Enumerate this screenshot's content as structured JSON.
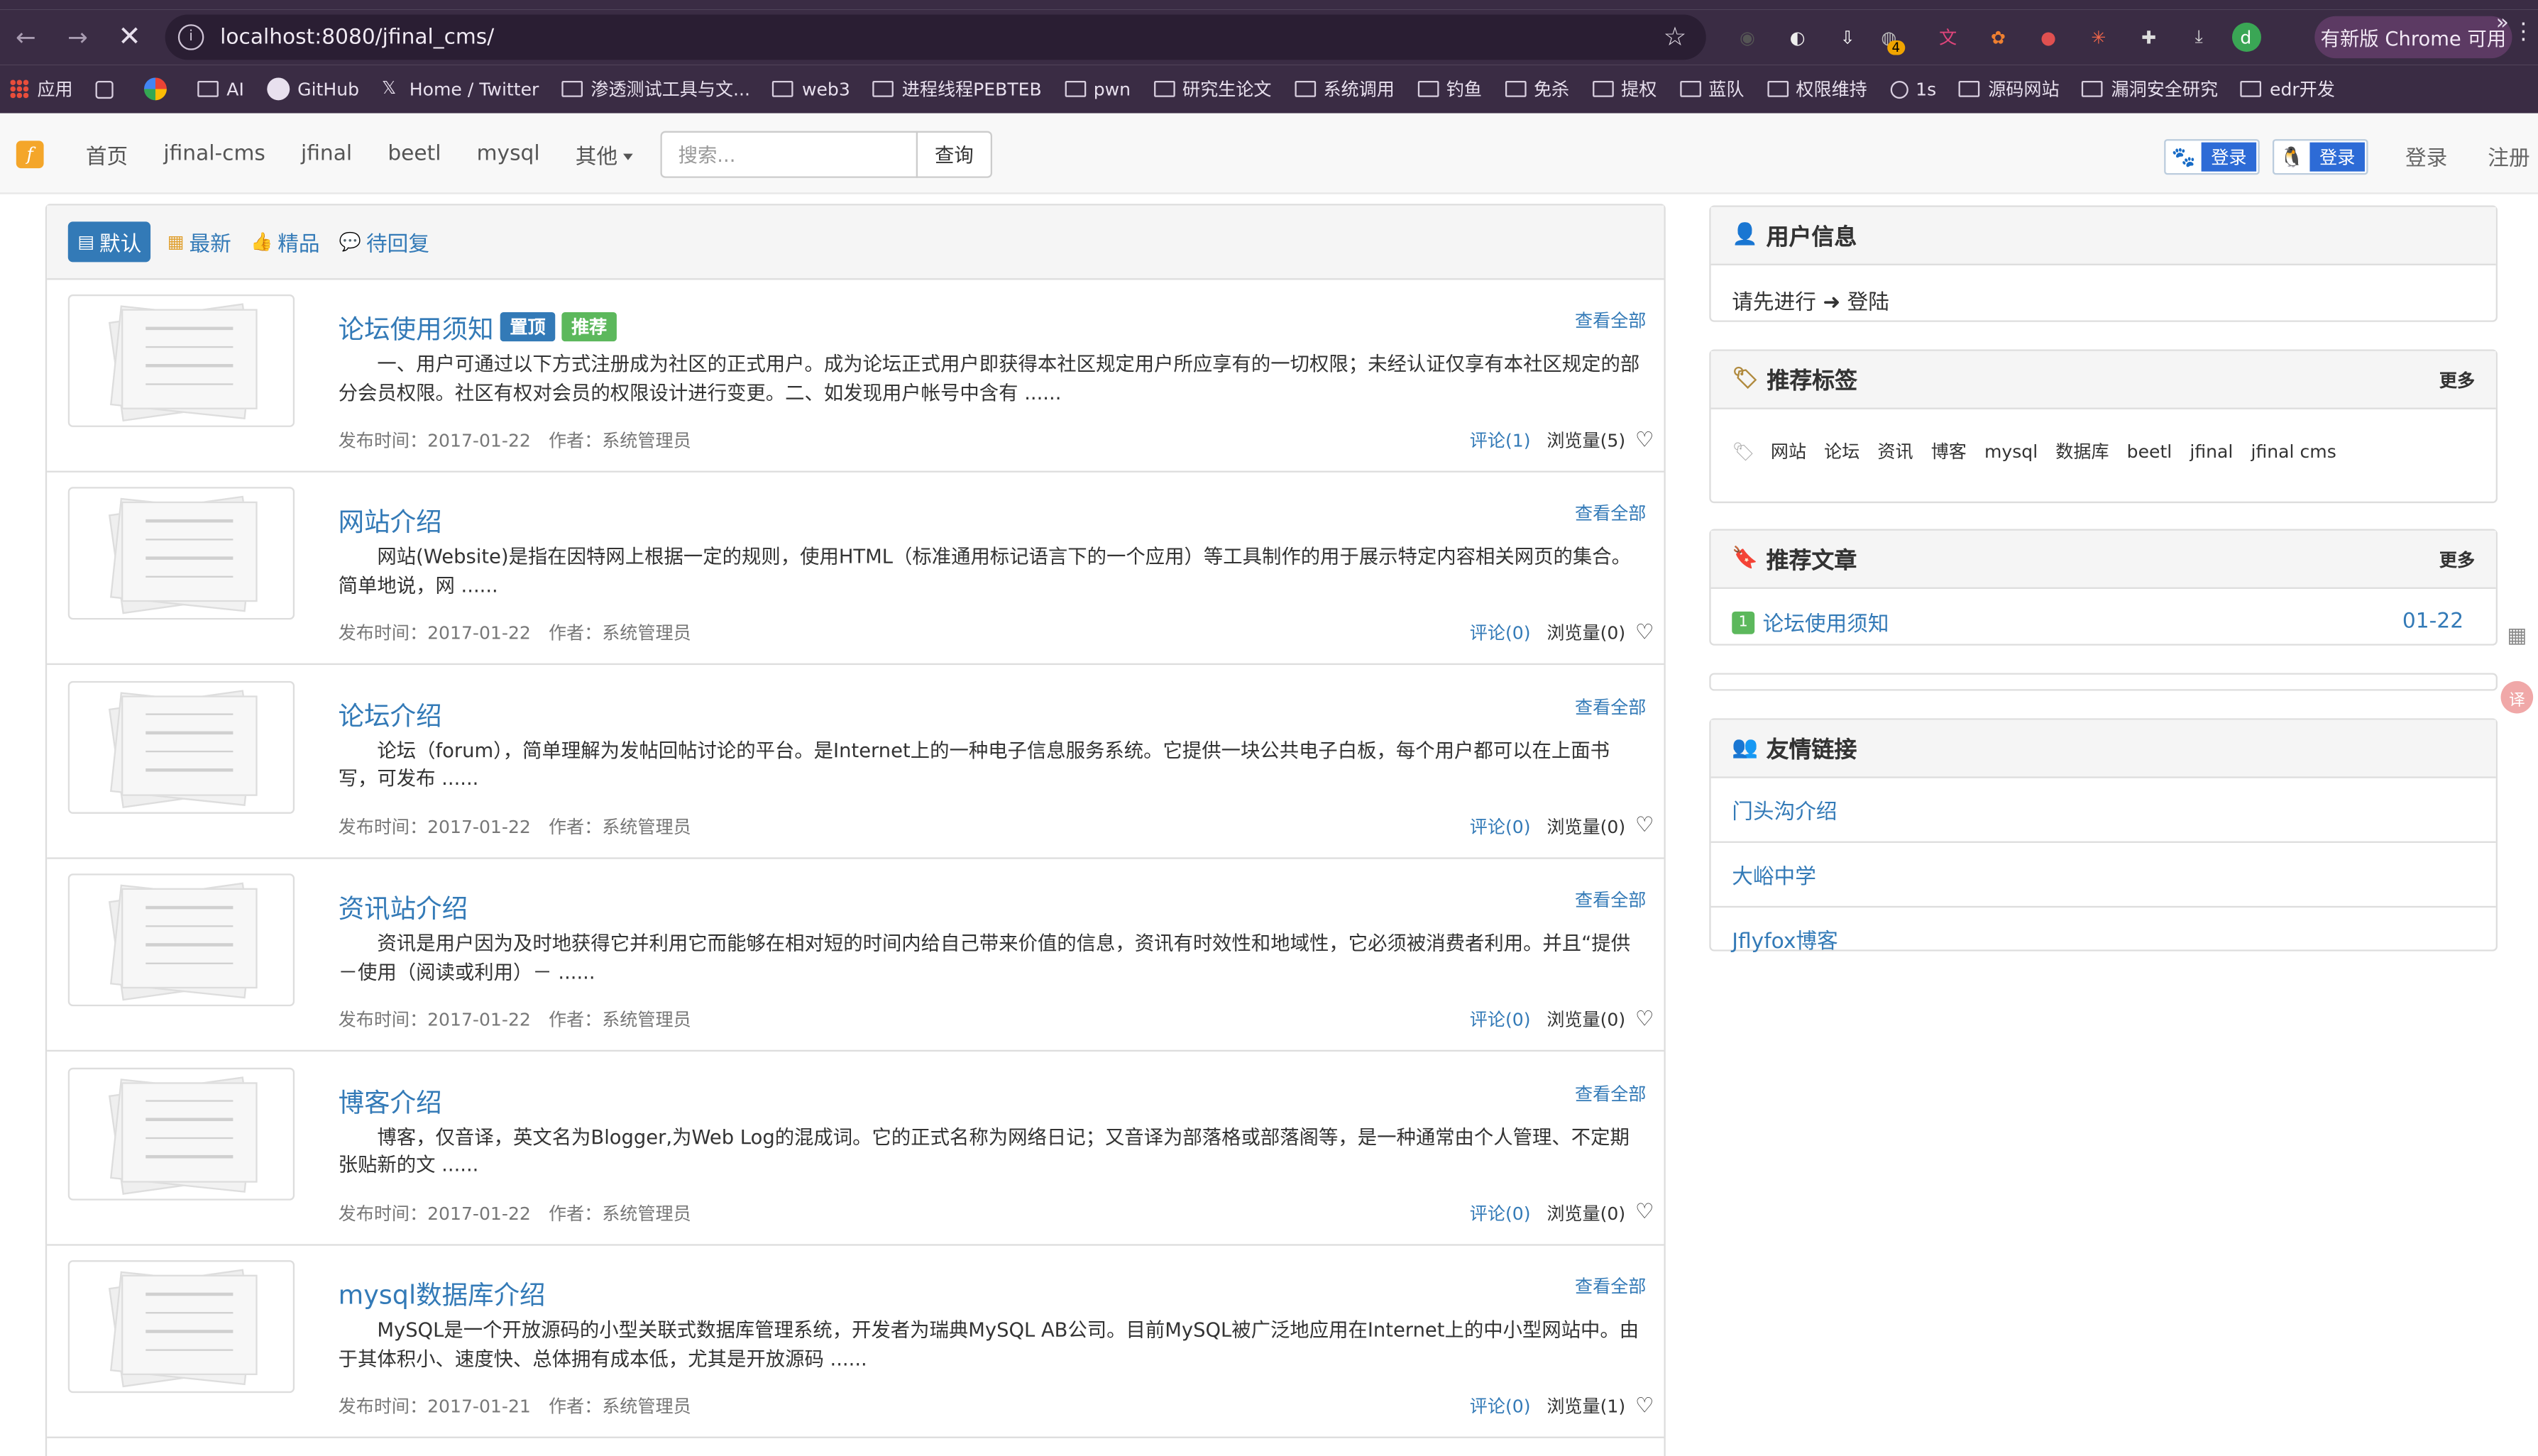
{
  "browser": {
    "url": "localhost:8080/jfinal_cms/",
    "update_label": "有新版 Chrome 可用",
    "extensions": [
      "eyes-ext-icon",
      "eye-ext-icon",
      "download-box-ext-icon",
      "chat-ext-icon",
      "translate-ext-icon",
      "fox-ext-icon",
      "record-ext-icon",
      "spark-ext-icon",
      "puzzle-icon",
      "download-icon",
      "profile-icon"
    ],
    "extension_badge": "4",
    "profile_initial": "d",
    "bookmarks": [
      {
        "label": "应用",
        "icon": "grid"
      },
      {
        "label": "",
        "icon": "grid2"
      },
      {
        "label": "",
        "icon": "g"
      },
      {
        "label": "AI",
        "icon": "folder"
      },
      {
        "label": "GitHub",
        "icon": "gh"
      },
      {
        "label": "Home / Twitter",
        "icon": "x"
      },
      {
        "label": "渗透测试工具与文...",
        "icon": "folder"
      },
      {
        "label": "web3",
        "icon": "folder"
      },
      {
        "label": "进程线程PEBTEB",
        "icon": "folder"
      },
      {
        "label": "pwn",
        "icon": "folder"
      },
      {
        "label": "研究生论文",
        "icon": "folder"
      },
      {
        "label": "系统调用",
        "icon": "folder"
      },
      {
        "label": "钓鱼",
        "icon": "folder"
      },
      {
        "label": "免杀",
        "icon": "folder"
      },
      {
        "label": "提权",
        "icon": "folder"
      },
      {
        "label": "蓝队",
        "icon": "folder"
      },
      {
        "label": "权限维持",
        "icon": "folder"
      },
      {
        "label": "1s",
        "icon": "globe"
      },
      {
        "label": "源码网站",
        "icon": "folder"
      },
      {
        "label": "漏洞安全研究",
        "icon": "folder"
      },
      {
        "label": "edr开发",
        "icon": "folder"
      }
    ]
  },
  "site": {
    "logo": "f",
    "nav": [
      "首页",
      "jfinal-cms",
      "jfinal",
      "beetl",
      "mysql"
    ],
    "nav_more": "其他",
    "search_placeholder": "搜索...",
    "search_button": "查询",
    "baidu_login": "登录",
    "qq_login": "登录",
    "login": "登录",
    "register": "注册"
  },
  "tabs": [
    {
      "label": "默认",
      "icon": "list-icon",
      "active": true
    },
    {
      "label": "最新",
      "icon": "calendar-icon",
      "active": false
    },
    {
      "label": "精品",
      "icon": "thumbs-up-icon",
      "active": false
    },
    {
      "label": "待回复",
      "icon": "comment-icon",
      "active": false
    }
  ],
  "posts": [
    {
      "title": "论坛使用须知",
      "badges": [
        {
          "label": "置顶",
          "color": "#337ab7"
        },
        {
          "label": "推荐",
          "color": "#5cb85c"
        }
      ],
      "view_all": "查看全部",
      "excerpt": "一、用户可通过以下方式注册成为社区的正式用户。成为论坛正式用户即获得本社区规定用户所应享有的一切权限；未经认证仅享有本社区规定的部分会员权限。社区有权对会员的权限设计进行变更。二、如发现用户帐号中含有 ......",
      "meta": "发布时间：2017-01-22　作者：系统管理员",
      "comments": "评论(1)",
      "views": "浏览量(5)"
    },
    {
      "title": "网站介绍",
      "badges": [],
      "view_all": "查看全部",
      "excerpt": "网站(Website)是指在因特网上根据一定的规则，使用HTML（标准通用标记语言下的一个应用）等工具制作的用于展示特定内容相关网页的集合。简单地说，网 ......",
      "meta": "发布时间：2017-01-22　作者：系统管理员",
      "comments": "评论(0)",
      "views": "浏览量(0)"
    },
    {
      "title": "论坛介绍",
      "badges": [],
      "view_all": "查看全部",
      "excerpt": "论坛（forum），简单理解为发帖回帖讨论的平台。是Internet上的一种电子信息服务系统。它提供一块公共电子白板，每个用户都可以在上面书写，可发布 ......",
      "meta": "发布时间：2017-01-22　作者：系统管理员",
      "comments": "评论(0)",
      "views": "浏览量(0)"
    },
    {
      "title": "资讯站介绍",
      "badges": [],
      "view_all": "查看全部",
      "excerpt": "资讯是用户因为及时地获得它并利用它而能够在相对短的时间内给自己带来价值的信息，资讯有时效性和地域性，它必须被消费者利用。并且“提供－使用（阅读或利用）－ ......",
      "meta": "发布时间：2017-01-22　作者：系统管理员",
      "comments": "评论(0)",
      "views": "浏览量(0)"
    },
    {
      "title": "博客介绍",
      "badges": [],
      "view_all": "查看全部",
      "excerpt": "博客，仅音译，英文名为Blogger,为Web Log的混成词。它的正式名称为网络日记；又音译为部落格或部落阁等，是一种通常由个人管理、不定期张贴新的文 ......",
      "meta": "发布时间：2017-01-22　作者：系统管理员",
      "comments": "评论(0)",
      "views": "浏览量(0)"
    },
    {
      "title": "mysql数据库介绍",
      "badges": [],
      "view_all": "查看全部",
      "excerpt": "MySQL是一个开放源码的小型关联式数据库管理系统，开发者为瑞典MySQL AB公司。目前MySQL被广泛地应用在Internet上的中小型网站中。由于其体积小、速度快、总体拥有成本低，尤其是开放源码 ......",
      "meta": "发布时间：2017-01-21　作者：系统管理员",
      "comments": "评论(0)",
      "views": "浏览量(1)"
    }
  ],
  "sidebar": {
    "user_info": {
      "title": "用户信息",
      "text": "请先进行",
      "login_link": "登陆"
    },
    "tags": {
      "title": "推荐标签",
      "more": "更多",
      "items": [
        "网站",
        "论坛",
        "资讯",
        "博客",
        "mysql",
        "数据库",
        "beetl",
        "jfinal",
        "jfinal cms"
      ]
    },
    "articles": {
      "title": "推荐文章",
      "more": "更多",
      "items": [
        {
          "rank": "1",
          "title": "论坛使用须知",
          "date": "01-22"
        }
      ]
    },
    "links": {
      "title": "友情链接",
      "items": [
        "门头沟介绍",
        "大峪中学",
        "Jflyfox博客"
      ]
    }
  }
}
